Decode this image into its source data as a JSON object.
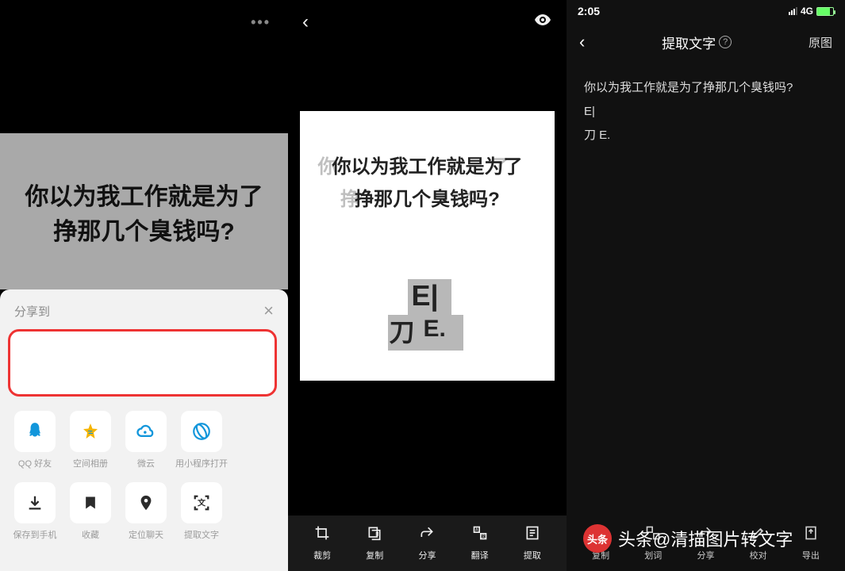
{
  "panel1": {
    "image_text_line1": "你以为我工作就是为了",
    "image_text_line2": "挣那几个臭钱吗?",
    "sheet_title": "分享到",
    "redbox": "",
    "share_row": [
      {
        "label": "QQ 好友",
        "icon": "qq"
      },
      {
        "label": "空间相册",
        "icon": "qzone"
      },
      {
        "label": "微云",
        "icon": "cloud"
      },
      {
        "label": "用小程序打开",
        "icon": "browser"
      }
    ],
    "action_row": [
      {
        "label": "保存到手机",
        "icon": "download"
      },
      {
        "label": "收藏",
        "icon": "bookmark"
      },
      {
        "label": "定位聊天",
        "icon": "location"
      },
      {
        "label": "提取文字",
        "icon": "ocr"
      }
    ]
  },
  "panel2": {
    "text_line1": "你以为我工作就是为了",
    "text_line2": "挣那几个臭钱吗?",
    "shadow_tail1": "为了",
    "shadow_tail2": "吗?",
    "glyph_e": "E|",
    "glyph_dao": "刀",
    "glyph_e2": "E.",
    "bottom": [
      {
        "label": "裁剪",
        "icon": "crop"
      },
      {
        "label": "复制",
        "icon": "copy"
      },
      {
        "label": "分享",
        "icon": "share"
      },
      {
        "label": "翻译",
        "icon": "translate"
      },
      {
        "label": "提取",
        "icon": "extract"
      }
    ]
  },
  "panel3": {
    "status_time": "2:05",
    "status_net": "4G",
    "title": "提取文字",
    "orig_btn": "原图",
    "body_lines": [
      "你以为我工作就是为了挣那几个臭钱吗?",
      "E|",
      "刀 E."
    ],
    "bottom": [
      {
        "label": "复制",
        "icon": "copy"
      },
      {
        "label": "划词",
        "icon": "select"
      },
      {
        "label": "分享",
        "icon": "share"
      },
      {
        "label": "校对",
        "icon": "proof"
      },
      {
        "label": "导出",
        "icon": "export"
      }
    ]
  },
  "watermark": "头条@清描图片转文字"
}
